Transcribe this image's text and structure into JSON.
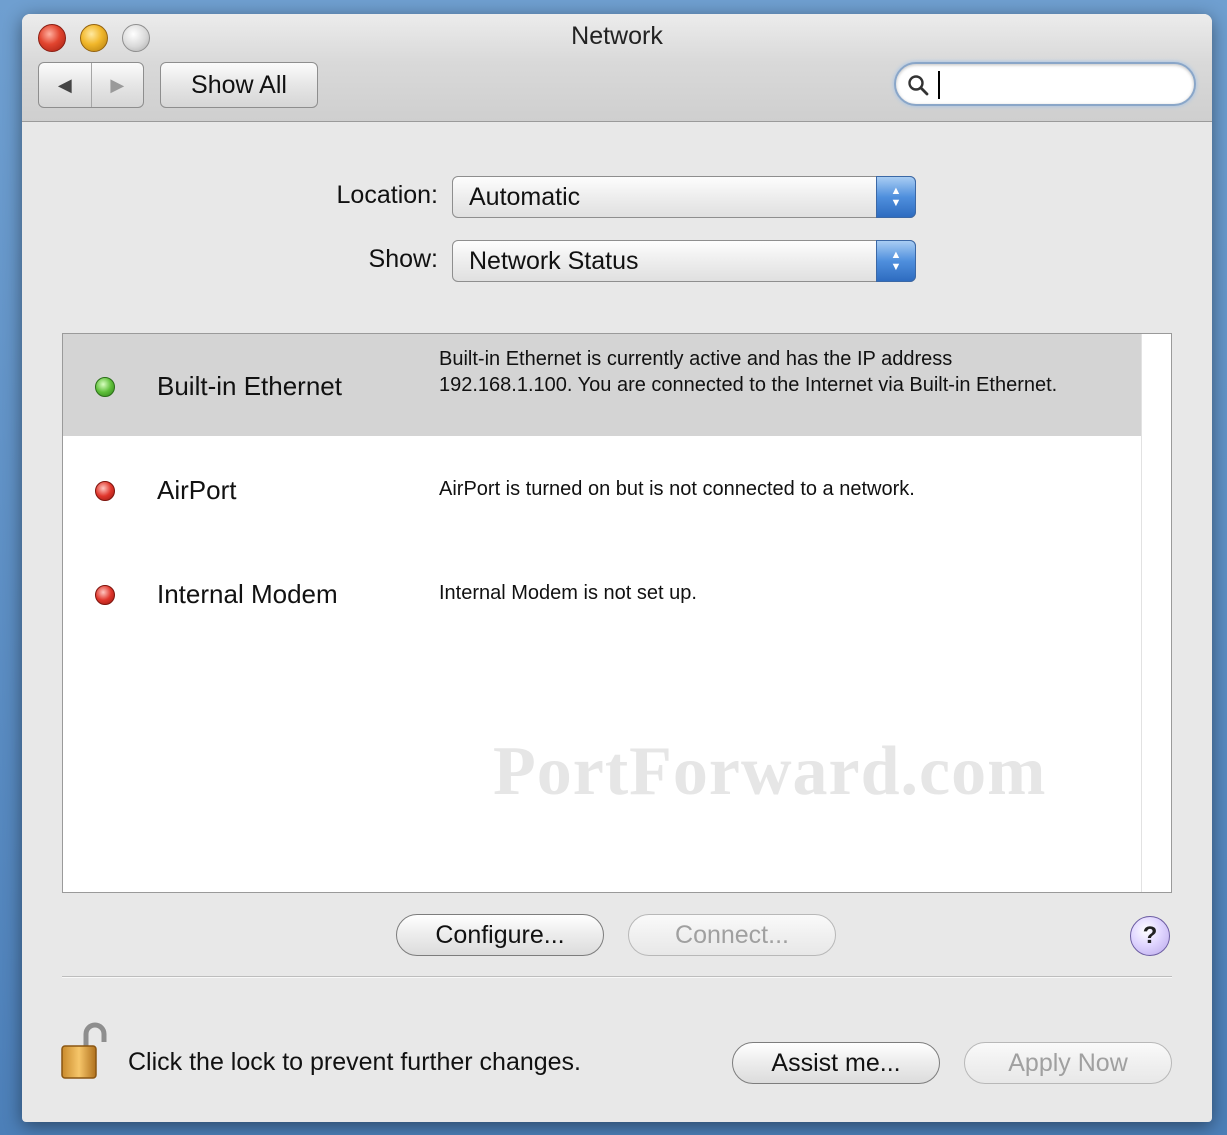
{
  "window": {
    "title": "Network"
  },
  "toolbar": {
    "back_icon": "◀",
    "forward_icon": "▶",
    "show_all_label": "Show All",
    "search_value": ""
  },
  "settings": {
    "location_label": "Location:",
    "location_value": "Automatic",
    "show_label": "Show:",
    "show_value": "Network Status"
  },
  "interfaces": [
    {
      "name": "Built-in Ethernet",
      "status_color": "green",
      "status_text": "Built-in Ethernet is currently active and has the IP address 192.168.1.100. You are connected to the Internet via Built-in Ethernet."
    },
    {
      "name": "AirPort",
      "status_color": "red",
      "status_text": "AirPort is turned on but is not connected to a network."
    },
    {
      "name": "Internal Modem",
      "status_color": "red",
      "status_text": "Internal Modem is not set up."
    }
  ],
  "watermark": "PortForward.com",
  "actions": {
    "configure_label": "Configure...",
    "connect_label": "Connect...",
    "help_label": "?",
    "assist_label": "Assist me...",
    "apply_label": "Apply Now"
  },
  "lock": {
    "message": "Click the lock to prevent further changes."
  },
  "colors": {
    "status_active": "#5fbf3a",
    "status_inactive": "#e0362c",
    "selected_row": "#d4d4d4"
  }
}
